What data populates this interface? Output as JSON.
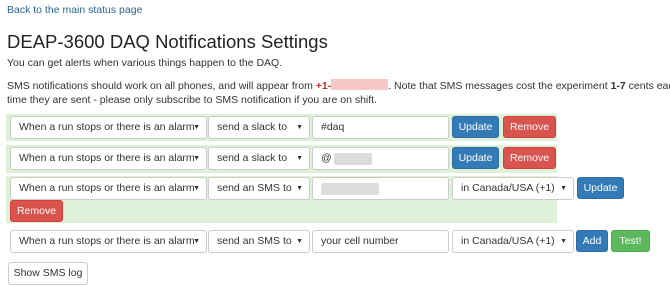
{
  "nav": {
    "back_link": "Back to the main status page"
  },
  "page": {
    "title": "DEAP-3600 DAQ Notifications Settings",
    "intro": "You can get alerts when various things happen to the DAQ.",
    "sms_note": {
      "part1": "SMS notifications should work on all phones, and will appear from ",
      "phone_prefix": "+1-",
      "part2": ". Note that SMS messages cost the experiment ",
      "cost": "1-7",
      "part3": " cents each time they are sent - please only subscribe to SMS notification if you are on shift."
    }
  },
  "subscriptions": [
    {
      "trigger": "When a run stops or there is an alarm",
      "method": "send a slack to",
      "target": "#daq",
      "update_label": "Update",
      "remove_label": "Remove"
    },
    {
      "trigger": "When a run stops or there is an alarm",
      "method": "send a slack to",
      "target": "@",
      "update_label": "Update",
      "remove_label": "Remove"
    },
    {
      "trigger": "When a run stops or there is an alarm",
      "method": "send an SMS to",
      "target": "",
      "region": "in Canada/USA (+1)",
      "update_label": "Update",
      "remove_label": "Remove"
    }
  ],
  "new_subscription": {
    "trigger": "When a run stops or there is an alarm",
    "method": "send an SMS to",
    "target_placeholder": "your cell number",
    "region": "in Canada/USA (+1)",
    "add_label": "Add",
    "test_label": "Test!"
  },
  "log_button": "Show SMS log",
  "colors": {
    "row_bg": "#dff0d8",
    "primary": "#337ab7",
    "danger": "#d9534f",
    "success": "#5cb85c",
    "link": "#2a6496"
  }
}
